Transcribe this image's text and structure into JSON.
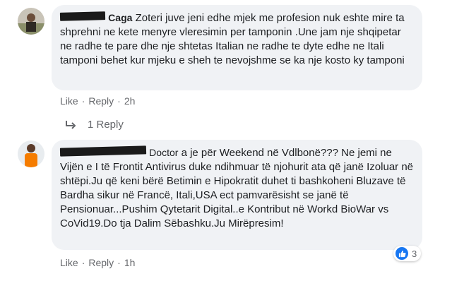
{
  "comments": [
    {
      "author_visible": "Caga",
      "text": "Zoteri juve jeni edhe mjek me profesion nuk eshte mire ta shprehni ne kete menyre vleresimin per tamponin .Une jam nje shqipetar ne radhe te pare dhe nje shtetas Italian ne radhe te dyte edhe ne Itali tamponi behet kur mjeku e sheh te nevojshme se ka nje kosto ky tamponi",
      "like_label": "Like",
      "reply_label": "Reply",
      "time": "2h",
      "replies_label": "1 Reply"
    },
    {
      "author_visible": "Doctor",
      "text": "a je për Weekend në Vdlbonë??? Ne jemi ne Vijën e I të Frontit Antivirus duke ndihmuar të njohurit ata që janë Izoluar në shtëpi.Ju që keni bërë Betimin e Hipokratit duhet ti bashkoheni Bluzave të Bardha sikur në Francë, Itali,USA ect pamvarësisht se janë të Pensionuar...Pushim Qytetarit Digital..e Kontribut në Workd BioWar vs CoVid19.Do tja Dalim Sëbashku.Ju Mirëpresim!",
      "like_label": "Like",
      "reply_label": "Reply",
      "time": "1h",
      "reaction_count": "3"
    }
  ],
  "colors": {
    "bubble": "#f0f2f5",
    "meta": "#65676b",
    "like_blue": "#1877f2"
  },
  "icons": [
    "avatar-icon",
    "reply-arrow-icon",
    "like-reaction-icon"
  ]
}
